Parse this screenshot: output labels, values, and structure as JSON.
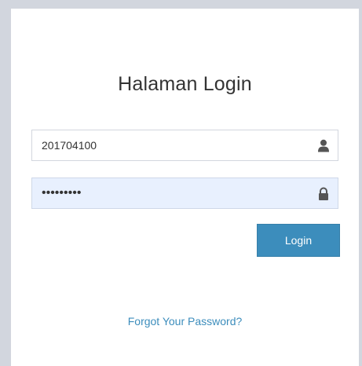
{
  "login": {
    "title": "Halaman Login",
    "username_value": "201704100",
    "password_value": "•••••••••",
    "submit_label": "Login",
    "forgot_label": "Forgot Your Password?",
    "user_icon": "user-icon",
    "password_icon": "lock-icon"
  },
  "colors": {
    "background": "#d2d6de",
    "accent": "#3c8dbc",
    "autofill": "#e8f0fe"
  }
}
